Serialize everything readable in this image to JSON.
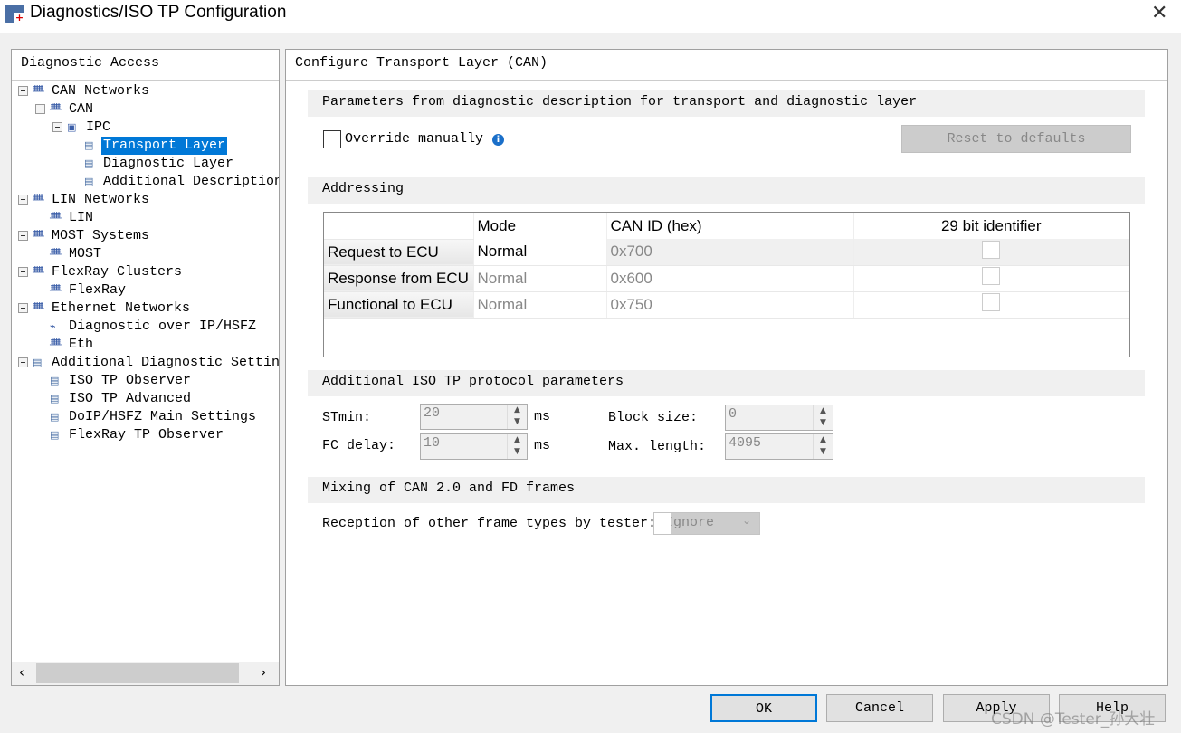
{
  "window": {
    "title": "Diagnostics/ISO TP Configuration",
    "close": "✕"
  },
  "left": {
    "header": "Diagnostic Access",
    "tree": [
      {
        "label": "CAN Networks",
        "level": 0,
        "box": true,
        "icon": "network-icon"
      },
      {
        "label": "CAN",
        "level": 1,
        "box": true,
        "icon": "network-icon"
      },
      {
        "label": "IPC",
        "level": 2,
        "box": true,
        "icon": "computer-icon"
      },
      {
        "label": "Transport Layer",
        "level": 3,
        "box": false,
        "icon": "config-icon",
        "selected": true
      },
      {
        "label": "Diagnostic Layer",
        "level": 3,
        "box": false,
        "icon": "config-icon"
      },
      {
        "label": "Additional Description",
        "level": 3,
        "box": false,
        "icon": "config-icon"
      },
      {
        "label": "LIN Networks",
        "level": 0,
        "box": true,
        "icon": "network-icon"
      },
      {
        "label": "LIN",
        "level": 1,
        "box": false,
        "icon": "network-icon"
      },
      {
        "label": "MOST Systems",
        "level": 0,
        "box": true,
        "icon": "network-icon"
      },
      {
        "label": "MOST",
        "level": 1,
        "box": false,
        "icon": "network-icon"
      },
      {
        "label": "FlexRay Clusters",
        "level": 0,
        "box": true,
        "icon": "network-icon"
      },
      {
        "label": "FlexRay",
        "level": 1,
        "box": false,
        "icon": "network-icon"
      },
      {
        "label": "Ethernet Networks",
        "level": 0,
        "box": true,
        "icon": "network-icon"
      },
      {
        "label": "Diagnostic over IP/HSFZ",
        "level": 1,
        "box": false,
        "icon": "cable-icon"
      },
      {
        "label": "Eth",
        "level": 1,
        "box": false,
        "icon": "network-icon"
      },
      {
        "label": "Additional Diagnostic Settings",
        "level": 0,
        "box": true,
        "icon": "config-icon"
      },
      {
        "label": "ISO TP Observer",
        "level": 1,
        "box": false,
        "icon": "config-icon"
      },
      {
        "label": "ISO TP Advanced",
        "level": 1,
        "box": false,
        "icon": "config-icon"
      },
      {
        "label": "DoIP/HSFZ Main Settings",
        "level": 1,
        "box": false,
        "icon": "config-icon"
      },
      {
        "label": "FlexRay TP Observer",
        "level": 1,
        "box": false,
        "icon": "config-icon"
      }
    ]
  },
  "right": {
    "header": "Configure Transport Layer (CAN)",
    "params": {
      "title": "Parameters from diagnostic description for transport and diagnostic layer",
      "override": "Override manually",
      "override_checked": false,
      "reset": "Reset to defaults"
    },
    "addressing": {
      "title": "Addressing",
      "columns": [
        "",
        "Mode",
        "CAN ID (hex)",
        "29 bit identifier"
      ],
      "rows": [
        {
          "name": "Request to ECU",
          "mode": "Normal",
          "id": "0x700",
          "ext": false
        },
        {
          "name": "Response from ECU",
          "mode": "Normal",
          "id": "0x600",
          "ext": false
        },
        {
          "name": "Functional to ECU",
          "mode": "Normal",
          "id": "0x750",
          "ext": false
        }
      ]
    },
    "isotp": {
      "title": "Additional ISO TP protocol parameters",
      "stmin_label": "STmin:",
      "stmin": "20",
      "fc_label": "FC delay:",
      "fc": "10",
      "unit": "ms",
      "bs_label": "Block size:",
      "bs": "0",
      "max_label": "Max. length:",
      "max": "4095"
    },
    "mixing": {
      "title": "Mixing of CAN 2.0 and FD frames",
      "label": "Reception of other frame types by tester:",
      "value": "Ignore"
    }
  },
  "buttons": {
    "ok": "OK",
    "cancel": "Cancel",
    "apply": "Apply",
    "help": "Help"
  },
  "watermark": "CSDN @Tester_孙大壮",
  "colors": {
    "selection": "#0078d7",
    "focus": "#0078d7"
  }
}
